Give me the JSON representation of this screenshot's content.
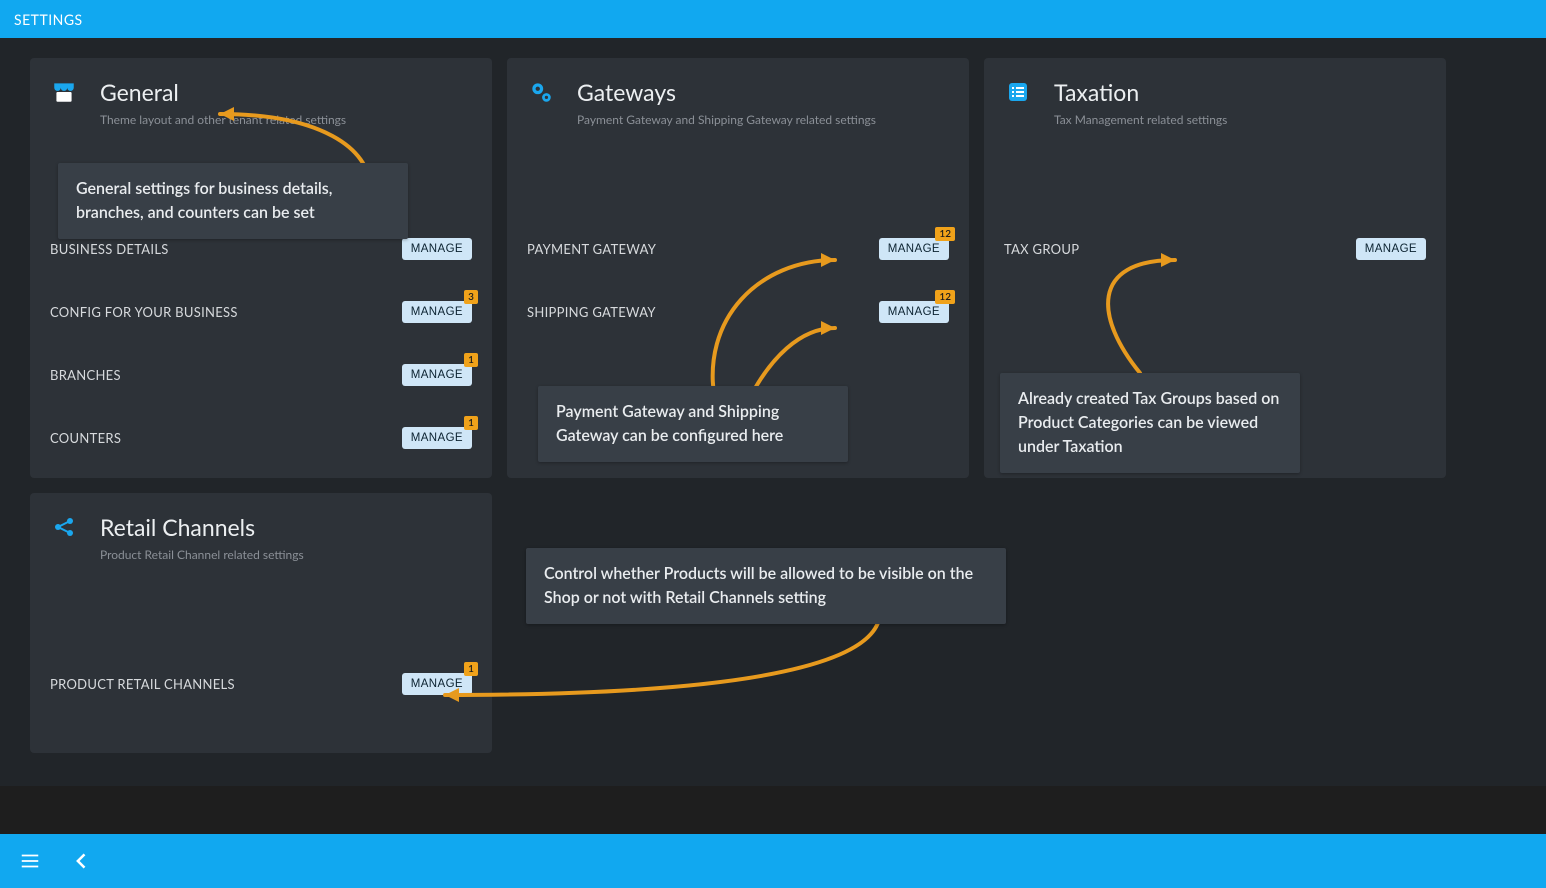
{
  "header": {
    "title": "SETTINGS"
  },
  "cards": {
    "general": {
      "title": "General",
      "subtitle": "Theme layout and other tenant related settings",
      "rows": [
        {
          "label": "BUSINESS DETAILS",
          "button": "MANAGE",
          "badge": null
        },
        {
          "label": "CONFIG FOR YOUR BUSINESS",
          "button": "MANAGE",
          "badge": "3"
        },
        {
          "label": "BRANCHES",
          "button": "MANAGE",
          "badge": "1"
        },
        {
          "label": "COUNTERS",
          "button": "MANAGE",
          "badge": "1"
        }
      ]
    },
    "gateways": {
      "title": "Gateways",
      "subtitle": "Payment Gateway and Shipping Gateway related settings",
      "rows": [
        {
          "label": "PAYMENT GATEWAY",
          "button": "MANAGE",
          "badge": "12"
        },
        {
          "label": "SHIPPING GATEWAY",
          "button": "MANAGE",
          "badge": "12"
        }
      ]
    },
    "taxation": {
      "title": "Taxation",
      "subtitle": "Tax Management related settings",
      "rows": [
        {
          "label": "TAX GROUP",
          "button": "MANAGE",
          "badge": null
        }
      ]
    },
    "retail": {
      "title": "Retail Channels",
      "subtitle": "Product Retail Channel related settings",
      "rows": [
        {
          "label": "PRODUCT RETAIL CHANNELS",
          "button": "MANAGE",
          "badge": "1"
        }
      ]
    }
  },
  "callouts": {
    "general": "General settings for business details, branches, and counters can be set",
    "gateways": "Payment Gateway and Shipping Gateway can be configured here",
    "taxation": "Already created Tax Groups based on Product Categories can be viewed under Taxation",
    "retail": "Control whether Products will be allowed to be visible on the Shop or not with Retail Channels setting"
  },
  "colors": {
    "accent": "#11a8f0",
    "badge": "#f0a21a",
    "button": "#cfe6f7"
  }
}
